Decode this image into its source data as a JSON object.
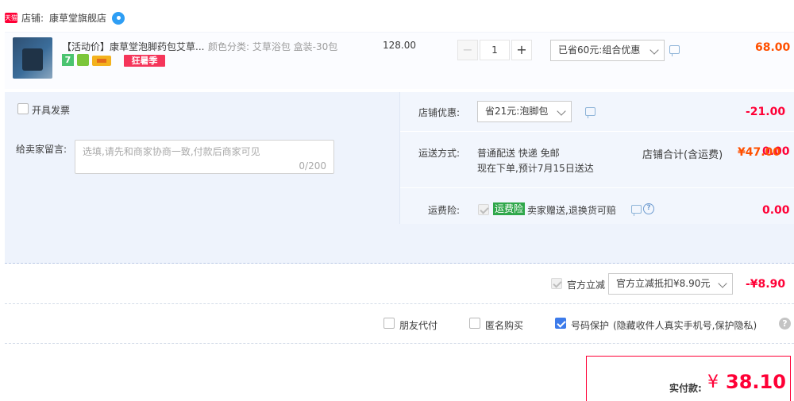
{
  "store": {
    "badge": "天猫",
    "label": "店铺:",
    "name": "康草堂旗舰店"
  },
  "item": {
    "title": "【活动价】康草堂泡脚药包艾草...",
    "sku": "颜色分类: 艾草浴包 盒装-30包",
    "icon7": "7",
    "promo_tag": "狂暑季",
    "unit_price": "128.00",
    "qty_minus": "−",
    "qty_plus": "+",
    "quantity": "1",
    "discount_option": "已省60元:组合优惠",
    "subtotal": "68.00"
  },
  "invoice": {
    "label": "开具发票"
  },
  "memo": {
    "label": "给卖家留言:",
    "placeholder": "选填,请先和商家协商一致,付款后商家可见",
    "counter": "0/200"
  },
  "shop_coupon": {
    "label": "店铺优惠:",
    "selected": "省21元:泡脚包",
    "amount": "-21.00"
  },
  "delivery": {
    "label": "运送方式:",
    "method": "普通配送 快递 免邮",
    "eta": "现在下单,预计7月15日送达",
    "amount": "0.00"
  },
  "insurance": {
    "label": "运费险:",
    "tag": "运费险",
    "text": "卖家赠送,退换货可赔",
    "amount": "0.00"
  },
  "shop_total": {
    "label": "店铺合计(含运费)",
    "amount": "¥47.00"
  },
  "official_discount": {
    "label": "官方立减",
    "selected": "官方立减抵扣¥8.90元",
    "amount": "-¥8.90"
  },
  "options": {
    "friend_pay": "朋友代付",
    "anonymous": "匿名购买",
    "number_protect": "号码保护",
    "number_protect_note": "(隐藏收件人真实手机号,保护隐私)",
    "help": "?"
  },
  "payment": {
    "label": "实付款:",
    "yen": "¥",
    "amount": "38.10"
  },
  "colors": {
    "accent_red": "#ff0036",
    "price_orange": "#ff5000",
    "checkbox_blue": "#3d7bea",
    "panel_blue": "#eef3fc"
  }
}
